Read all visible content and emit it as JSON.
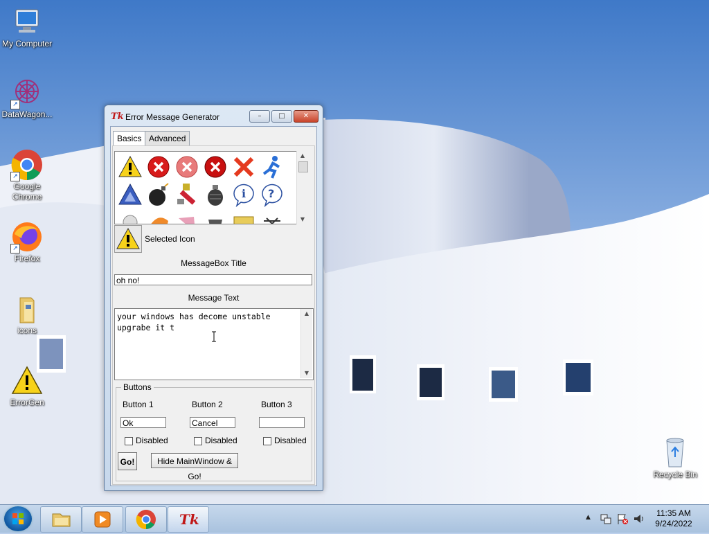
{
  "desktop": {
    "icons": [
      {
        "label": "My Computer"
      },
      {
        "label": "DataWagon..."
      },
      {
        "label": "Google Chrome"
      },
      {
        "label": "Firefox"
      },
      {
        "label": "icons"
      },
      {
        "label": "ErrorGen"
      },
      {
        "label": "Recycle Bin"
      }
    ]
  },
  "window": {
    "title": "Error Message Generator",
    "app_icon_text": "Tk",
    "caption_min": "–",
    "caption_max": "□",
    "caption_close": "✕",
    "tabs": [
      {
        "label": "Basics"
      },
      {
        "label": "Advanced"
      }
    ],
    "icon_grid": {
      "icons": [
        "warning-icon",
        "error-x-icon",
        "error-x-faded-icon",
        "error-x-icon",
        "red-x-icon",
        "running-man-icon",
        "aim-triangle-icon",
        "bomb-icon",
        "plug-icon",
        "grenade-icon",
        "info-icon",
        "question-icon"
      ]
    },
    "selected_icon_label": "Selected Icon",
    "messagebox_title_label": "MessageBox Title",
    "messagebox_title_value": "oh no!",
    "message_text_label": "Message Text",
    "message_text_value": "your windows has decome unstable\nupgrabe it t",
    "buttons_frame_label": "Buttons",
    "buttons": [
      {
        "label": "Button 1",
        "value": "Ok",
        "disabled_label": "Disabled"
      },
      {
        "label": "Button 2",
        "value": "Cancel",
        "disabled_label": "Disabled"
      },
      {
        "label": "Button 3",
        "value": "",
        "disabled_label": "Disabled"
      }
    ],
    "go_label": "Go!",
    "hide_go_label": "Hide MainWindow & Go!"
  },
  "taskbar": {
    "items": [
      "explorer-icon",
      "media-player-icon",
      "chrome-icon",
      "tk-app-icon"
    ],
    "tk_text": "Tk",
    "time": "11:35 AM",
    "date": "9/24/2022"
  },
  "colors": {
    "accent": "#1a5aa0",
    "error_red": "#d81b1b",
    "warning_yellow": "#f7d21a"
  }
}
